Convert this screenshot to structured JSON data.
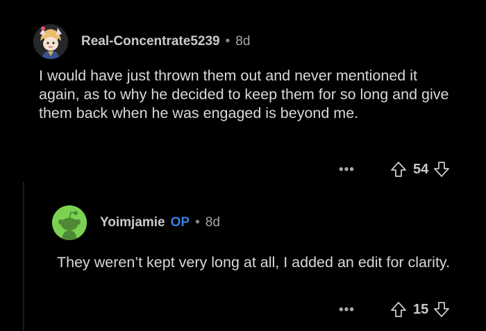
{
  "comment1": {
    "username": "Real-Concentrate5239",
    "separator": "•",
    "age": "8d",
    "body": "I would have just thrown them out and never mentioned it again, as to why he decided to keep them for so long and give them back when he was engaged is beyond me.",
    "more_label": "•••",
    "score": "54",
    "avatar_icon": "anime-character-avatar"
  },
  "comment2": {
    "username": "Yoimjamie",
    "op_badge": "OP",
    "separator": "•",
    "age": "8d",
    "body": "They weren’t kept very long at all, I added an edit for clarity.",
    "more_label": "•••",
    "score": "15",
    "avatar_icon": "snoo-avatar"
  },
  "colors": {
    "background": "#000000",
    "text": "#d7dadc",
    "op": "#3d7de0",
    "avatar_green": "#7bd151"
  }
}
